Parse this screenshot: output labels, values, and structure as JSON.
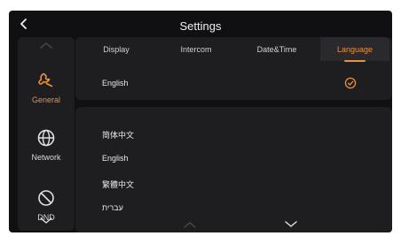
{
  "header": {
    "title": "Settings",
    "back_icon": "chevron-left-icon"
  },
  "sidebar": {
    "items": [
      {
        "label": "General",
        "icon": "wrench-icon",
        "active": true
      },
      {
        "label": "Network",
        "icon": "globe-icon",
        "active": false
      },
      {
        "label": "DND",
        "icon": "do-not-disturb-icon",
        "active": false
      }
    ]
  },
  "tabs": [
    {
      "label": "Display",
      "active": false
    },
    {
      "label": "Intercom",
      "active": false
    },
    {
      "label": "Date&Time",
      "active": false
    },
    {
      "label": "Language",
      "active": true
    }
  ],
  "current_language": {
    "value": "English",
    "selected_icon": "check-circle-icon"
  },
  "language_list": {
    "items": [
      "简体中文",
      "English",
      "繁體中文",
      "עברית"
    ]
  },
  "colors": {
    "accent": "#e8913e",
    "background": "#101012",
    "panel": "#1e1e21",
    "text": "#e8e8e8"
  }
}
